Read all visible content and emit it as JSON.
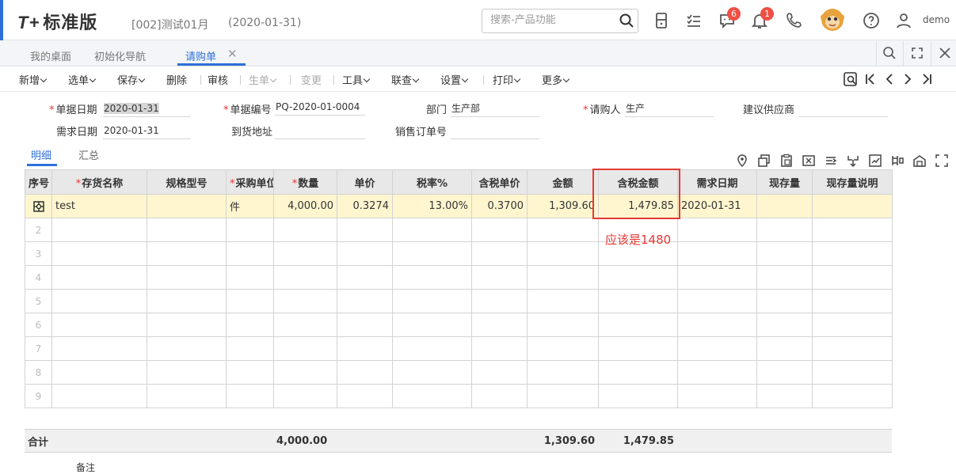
{
  "header": {
    "logo_mark": "T+",
    "logo_text": "标准版",
    "account": "[002]测试01月",
    "date": "(2020-01-31)",
    "search_placeholder": "搜索-产品功能",
    "messages_badge": "6",
    "notify_badge": "1",
    "user": "demo"
  },
  "tabs": [
    {
      "label": "我的桌面"
    },
    {
      "label": "初始化导航"
    },
    {
      "label": "请购单"
    }
  ],
  "toolbar": {
    "add": "新增",
    "select": "选单",
    "save": "保存",
    "delete": "删除",
    "audit": "审核",
    "generate": "生单",
    "change": "变更",
    "tools": "工具",
    "lookup": "联查",
    "settings": "设置",
    "print": "打印",
    "more": "更多"
  },
  "form": {
    "doc_date_label": "单据日期",
    "doc_date": "2020-01-31",
    "doc_no_label": "单据编号",
    "doc_no": "PQ-2020-01-0004",
    "dept_label": "部门",
    "dept": "生产部",
    "buyer_label": "请购人",
    "buyer": "生产",
    "supplier_label": "建议供应商",
    "supplier": "",
    "need_date_label": "需求日期",
    "need_date": "2020-01-31",
    "address_label": "到货地址",
    "address": "",
    "sales_order_label": "销售订单号",
    "sales_order": ""
  },
  "subtabs": [
    "明细",
    "汇总"
  ],
  "columns": [
    "序号",
    "存货名称",
    "规格型号",
    "采购单位",
    "数量",
    "单价",
    "税率%",
    "含税单价",
    "金额",
    "含税金额",
    "需求日期",
    "现存量",
    "现存量说明"
  ],
  "rows": [
    {
      "idx": "",
      "name": "test",
      "spec": "",
      "unit": "件",
      "qty": "4,000.00",
      "price": "0.3274",
      "tax_rate": "13.00%",
      "tax_price": "0.3700",
      "amount": "1,309.60",
      "tax_amount": "1,479.85",
      "need_date": "2020-01-31",
      "stock": "",
      "stock_note": ""
    },
    {
      "idx": "2"
    },
    {
      "idx": "3"
    },
    {
      "idx": "4"
    },
    {
      "idx": "5"
    },
    {
      "idx": "6"
    },
    {
      "idx": "7"
    },
    {
      "idx": "8"
    },
    {
      "idx": "9"
    }
  ],
  "annotation": "应该是1480",
  "total": {
    "label": "合计",
    "qty": "4,000.00",
    "amount": "1,309.60",
    "tax_amount": "1,479.85"
  },
  "remark_label": "备注",
  "colors": {
    "accent": "#2e6fd9",
    "highlight_row": "#fff6cf",
    "annotation": "#e53935",
    "badge": "#f04f44"
  }
}
